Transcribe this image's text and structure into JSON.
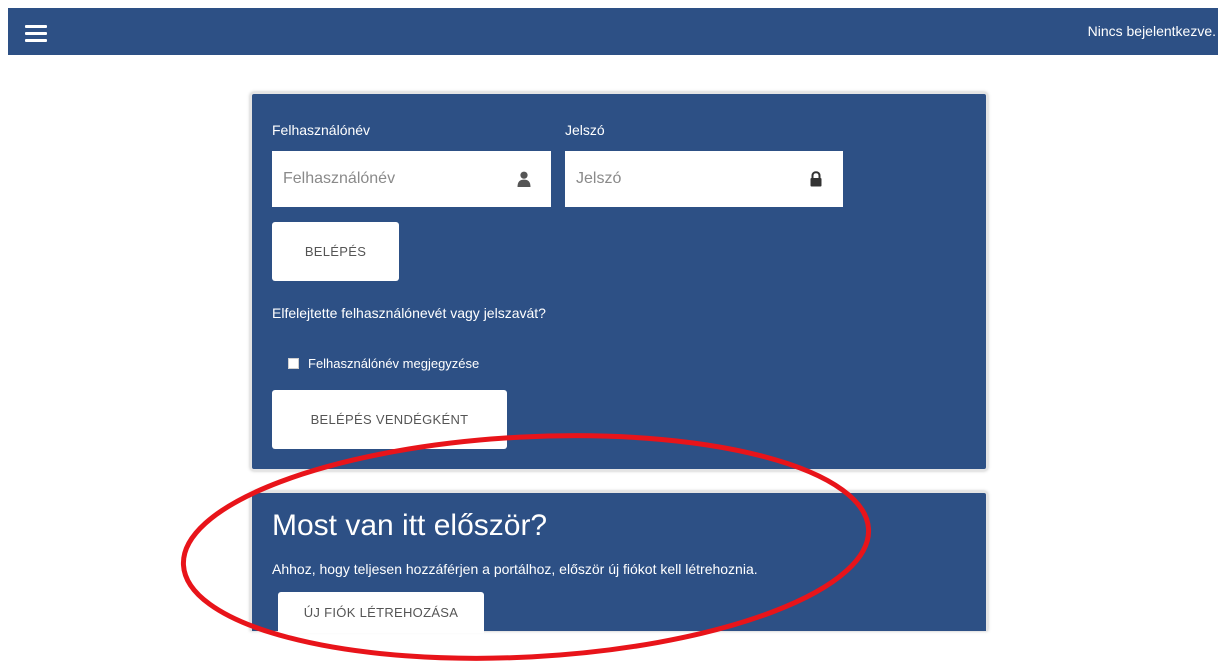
{
  "header": {
    "status_text": "Nincs bejelentkezve."
  },
  "login": {
    "username_label": "Felhasználónév",
    "username_placeholder": "Felhasználónév",
    "password_label": "Jelszó",
    "password_placeholder": "Jelszó",
    "login_button": "BELÉPÉS",
    "forgot_link": "Elfelejtette felhasználónevét vagy jelszavát?",
    "remember_label": "Felhasználónév megjegyzése",
    "guest_button": "BELÉPÉS VENDÉGKÉNT"
  },
  "first_time": {
    "title": "Most van itt először?",
    "text": "Ahhoz, hogy teljesen hozzáférjen a portálhoz, először új fiókot kell létrehoznia.",
    "create_button": "ÚJ FIÓK LÉTREHOZÁSA"
  },
  "icons": {
    "menu": "hamburger-menu-icon",
    "user": "user-icon",
    "lock": "lock-icon"
  },
  "colors": {
    "brand_blue": "#2d5085",
    "annotation_red": "#e8141a"
  }
}
